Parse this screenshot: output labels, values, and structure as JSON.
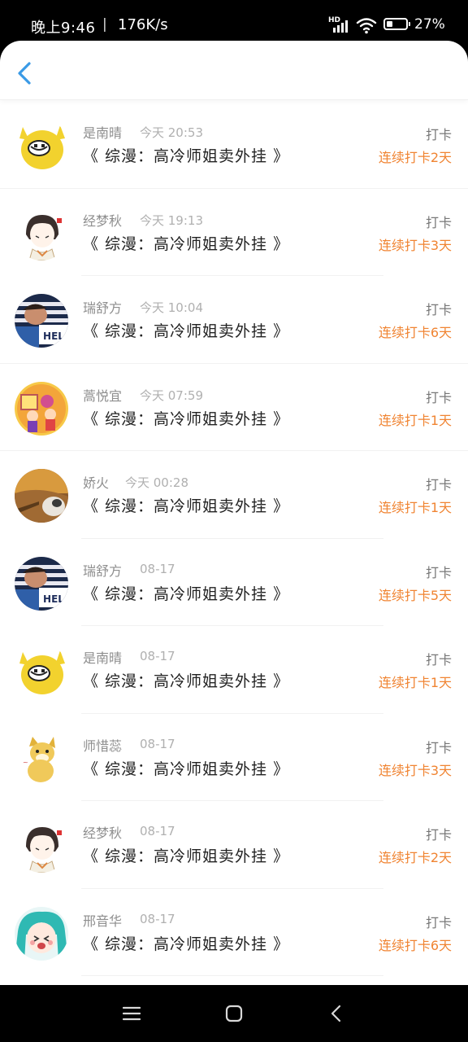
{
  "status_bar": {
    "time": "晚上9:46",
    "separator": "|",
    "net_speed": "176K/s",
    "hd_label": "HD",
    "battery": "27%",
    "icons": [
      "signal-icon",
      "wifi-icon",
      "battery-icon"
    ]
  },
  "header": {
    "back_icon": "chevron-left-icon",
    "accent_color": "#3a9ae6"
  },
  "colors": {
    "streak": "#f08432",
    "name": "#8e8e8e",
    "time": "#b0b0b0"
  },
  "records": [
    {
      "name": "是南晴",
      "time": "今天 20:53",
      "book": "《 综漫：高冷师姐卖外挂 》",
      "action": "打卡",
      "streak": "连续打卡2天",
      "avatar": "pikachu-meme-avatar"
    },
    {
      "name": "经梦秋",
      "time": "今天 19:13",
      "book": "《 综漫：高冷师姐卖外挂 》",
      "action": "打卡",
      "streak": "连续打卡3天",
      "avatar": "anime-girl-avatar"
    },
    {
      "name": "瑞舒方",
      "time": "今天 10:04",
      "book": "《 综漫：高冷师姐卖外挂 》",
      "action": "打卡",
      "streak": "连续打卡6天",
      "avatar": "help-sign-avatar"
    },
    {
      "name": "蒿悦宜",
      "time": "今天 07:59",
      "book": "《 综漫：高冷师姐卖外挂 》",
      "action": "打卡",
      "streak": "连续打卡1天",
      "avatar": "cartoon-kids-avatar"
    },
    {
      "name": "娇火",
      "time": "今天 00:28",
      "book": "《 综漫：高冷师姐卖外挂 》",
      "action": "打卡",
      "streak": "连续打卡1天",
      "avatar": "autumn-animal-avatar"
    },
    {
      "name": "瑞舒方",
      "time": "08-17",
      "book": "《 综漫：高冷师姐卖外挂 》",
      "action": "打卡",
      "streak": "连续打卡5天",
      "avatar": "help-sign-avatar"
    },
    {
      "name": "是南晴",
      "time": "08-17",
      "book": "《 综漫：高冷师姐卖外挂 》",
      "action": "打卡",
      "streak": "连续打卡1天",
      "avatar": "pikachu-meme-avatar"
    },
    {
      "name": "师惜蕊",
      "time": "08-17",
      "book": "《 综漫：高冷师姐卖外挂 》",
      "action": "打卡",
      "streak": "连续打卡3天",
      "avatar": "doge-avatar"
    },
    {
      "name": "经梦秋",
      "time": "08-17",
      "book": "《 综漫：高冷师姐卖外挂 》",
      "action": "打卡",
      "streak": "连续打卡2天",
      "avatar": "anime-girl-avatar"
    },
    {
      "name": "邢音华",
      "time": "08-17",
      "book": "《 综漫：高冷师姐卖外挂 》",
      "action": "打卡",
      "streak": "连续打卡6天",
      "avatar": "miku-avatar"
    }
  ],
  "nav_bar": {
    "items": [
      "menu-icon",
      "home-icon",
      "back-icon"
    ]
  }
}
